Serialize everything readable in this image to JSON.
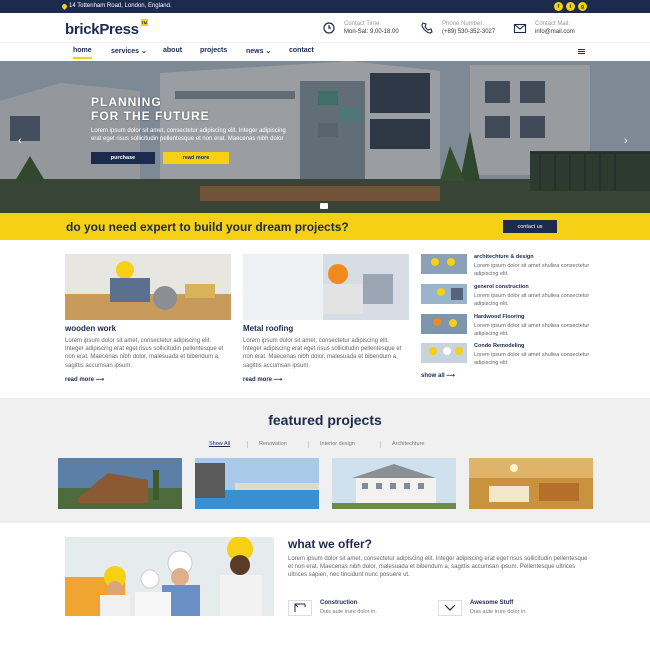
{
  "colors": {
    "navy": "#1c2a4e",
    "yellow": "#f5d014",
    "grey_bg": "#f0f0f0"
  },
  "topbar": {
    "address": "14 Tottenham Road, London, England.",
    "socials": [
      {
        "icon": "facebook-icon",
        "glyph": "f"
      },
      {
        "icon": "twitter-icon",
        "glyph": "t"
      },
      {
        "icon": "google-plus-icon",
        "glyph": "g"
      }
    ]
  },
  "header": {
    "logo": "brickPress",
    "logo_badge": "TM",
    "contacts": [
      {
        "icon": "clock-icon",
        "label": "Contact Time:",
        "value": "Mon-Sat: 9.00-18.00"
      },
      {
        "icon": "phone-icon",
        "label": "Phone Number:",
        "value": "(+89) 530-352-3027"
      },
      {
        "icon": "mail-icon",
        "label": "Contact Mail:",
        "value": "info@mail.com"
      }
    ]
  },
  "nav": {
    "items": [
      "home",
      "services ⌄",
      "about",
      "projects",
      "news ⌄",
      "contact"
    ]
  },
  "hero": {
    "title_line1": "PLANNING",
    "title_line2": "FOR THE FUTURE",
    "text": "Lorem ipsum dolor sit amet, consectetur adipiscing elit. Integer adipiscing erat eget risus sollicitudin pellentesque et non erat. Maecenas nibh dolor",
    "btn_purchase": "purchase",
    "btn_read_more": "read more",
    "prev": "‹",
    "next": "›"
  },
  "banner": {
    "text": "do you need expert to build your dream projects?",
    "button": "contact us"
  },
  "services": [
    {
      "title": "wooden work",
      "text": "Lorem ipsum dolor sit amet, consectetur adipiscing elit. Integer adipiscing erat eget risus sollicitudin pellentesque et non erat. Maecenas nibh dolor, malesuada et bibendum a, sagittis accumsan ipsum.",
      "more": "read more ⟶"
    },
    {
      "title": "Metal roofing",
      "text": "Lorem ipsum dolor sit amet, consectetur adipiscing elit. Integer adipiscing erat eget risus sollicitudin pellentesque et non erat. Maecenas nibh dolor, malesuada et bibendum a, sagittis accumsan ipsum.",
      "more": "read more ⟶"
    }
  ],
  "side_services": [
    {
      "title": "architechture & design",
      "text": "Lorem ipsum dolor sit amet shuliea consectetur adipiscing elit."
    },
    {
      "title": "generol construction",
      "text": "Lorem ipsum dolor sit amet shuliea consectetur adipiscing elit."
    },
    {
      "title": "Hardwood Flooring",
      "text": "Lorem ipsum dolor sit amet shuliea consectetur adipiscing elit."
    },
    {
      "title": "Condo Remodeling",
      "text": "Lorem ipsum dolor sit amet shuliea consectetur adipiscing elit."
    }
  ],
  "show_all": "show all ⟶",
  "featured": {
    "title": "featured projects",
    "tabs": [
      "Show All",
      "Renovation",
      "Interior design",
      "Architechture"
    ]
  },
  "offer": {
    "title": "what we offer?",
    "text": "Lorem ipsum dolor sit amet, consectetur adipiscing elit. Integer adipiscing erat eget risus sollicitudin pellentesque et non erat. Maecenas nibh dolor, malesuada et bibendum a, sagittis accumsan ipsum. Pellentesque ultrices ultrices sapien, nec tincidunt nunc posuere ut.",
    "features": [
      {
        "icon": "crane-icon",
        "title": "Construction",
        "text": "Duis aute irure dolor in."
      },
      {
        "icon": "chevron-down-icon",
        "title": "Awesome Stuff",
        "text": "Duis aute irure dolor in."
      }
    ]
  }
}
